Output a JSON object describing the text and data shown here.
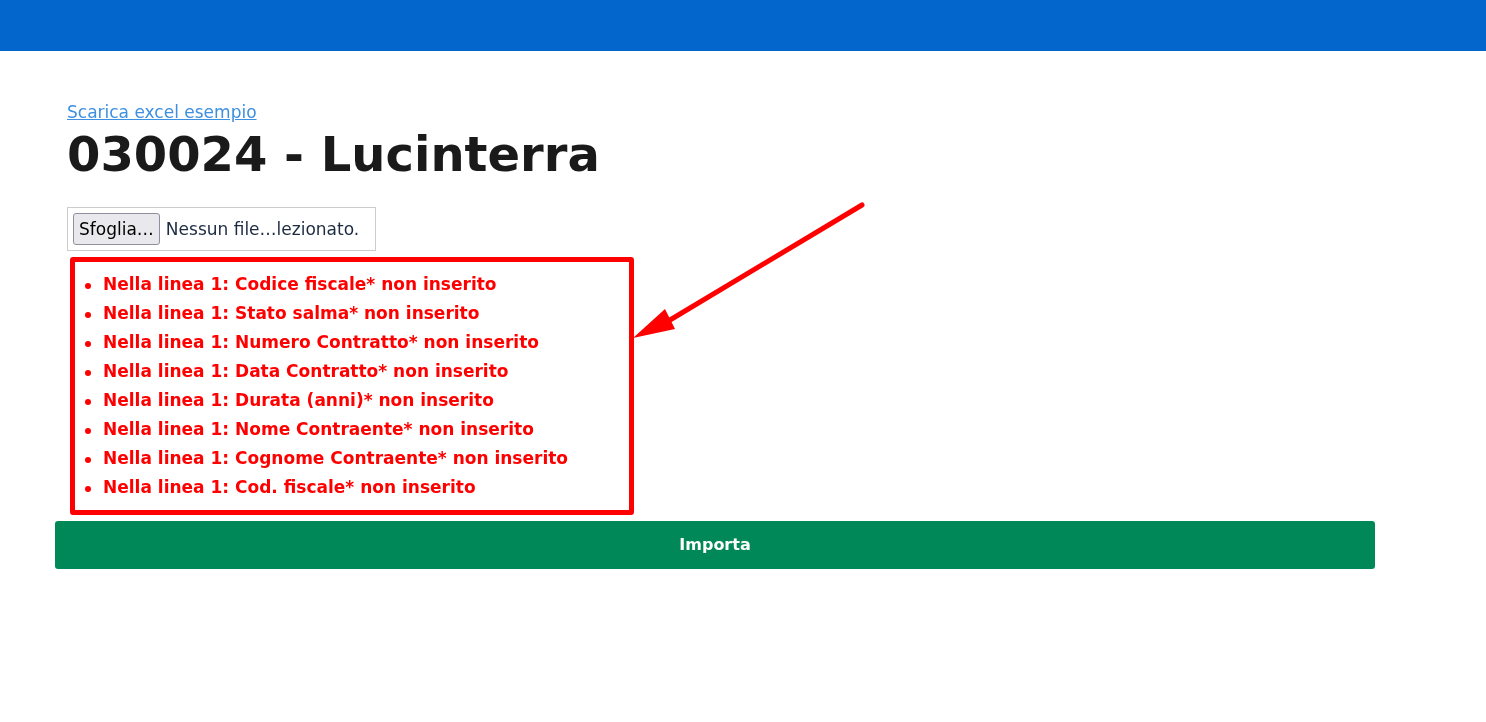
{
  "link": "Scarica excel esempio",
  "title": "030024 - Lucinterra",
  "file_input": {
    "button": "Sfoglia…",
    "status": "Nessun file…lezionato."
  },
  "errors": [
    "Nella linea 1: Codice fiscale* non inserito",
    "Nella linea 1: Stato salma* non inserito",
    "Nella linea 1: Numero Contratto* non inserito",
    "Nella linea 1: Data Contratto* non inserito",
    "Nella linea 1: Durata (anni)* non inserito",
    "Nella linea 1: Nome Contraente* non inserito",
    "Nella linea 1: Cognome Contraente* non inserito",
    "Nella linea 1: Cod. fiscale* non inserito"
  ],
  "submit_button": "Importa"
}
